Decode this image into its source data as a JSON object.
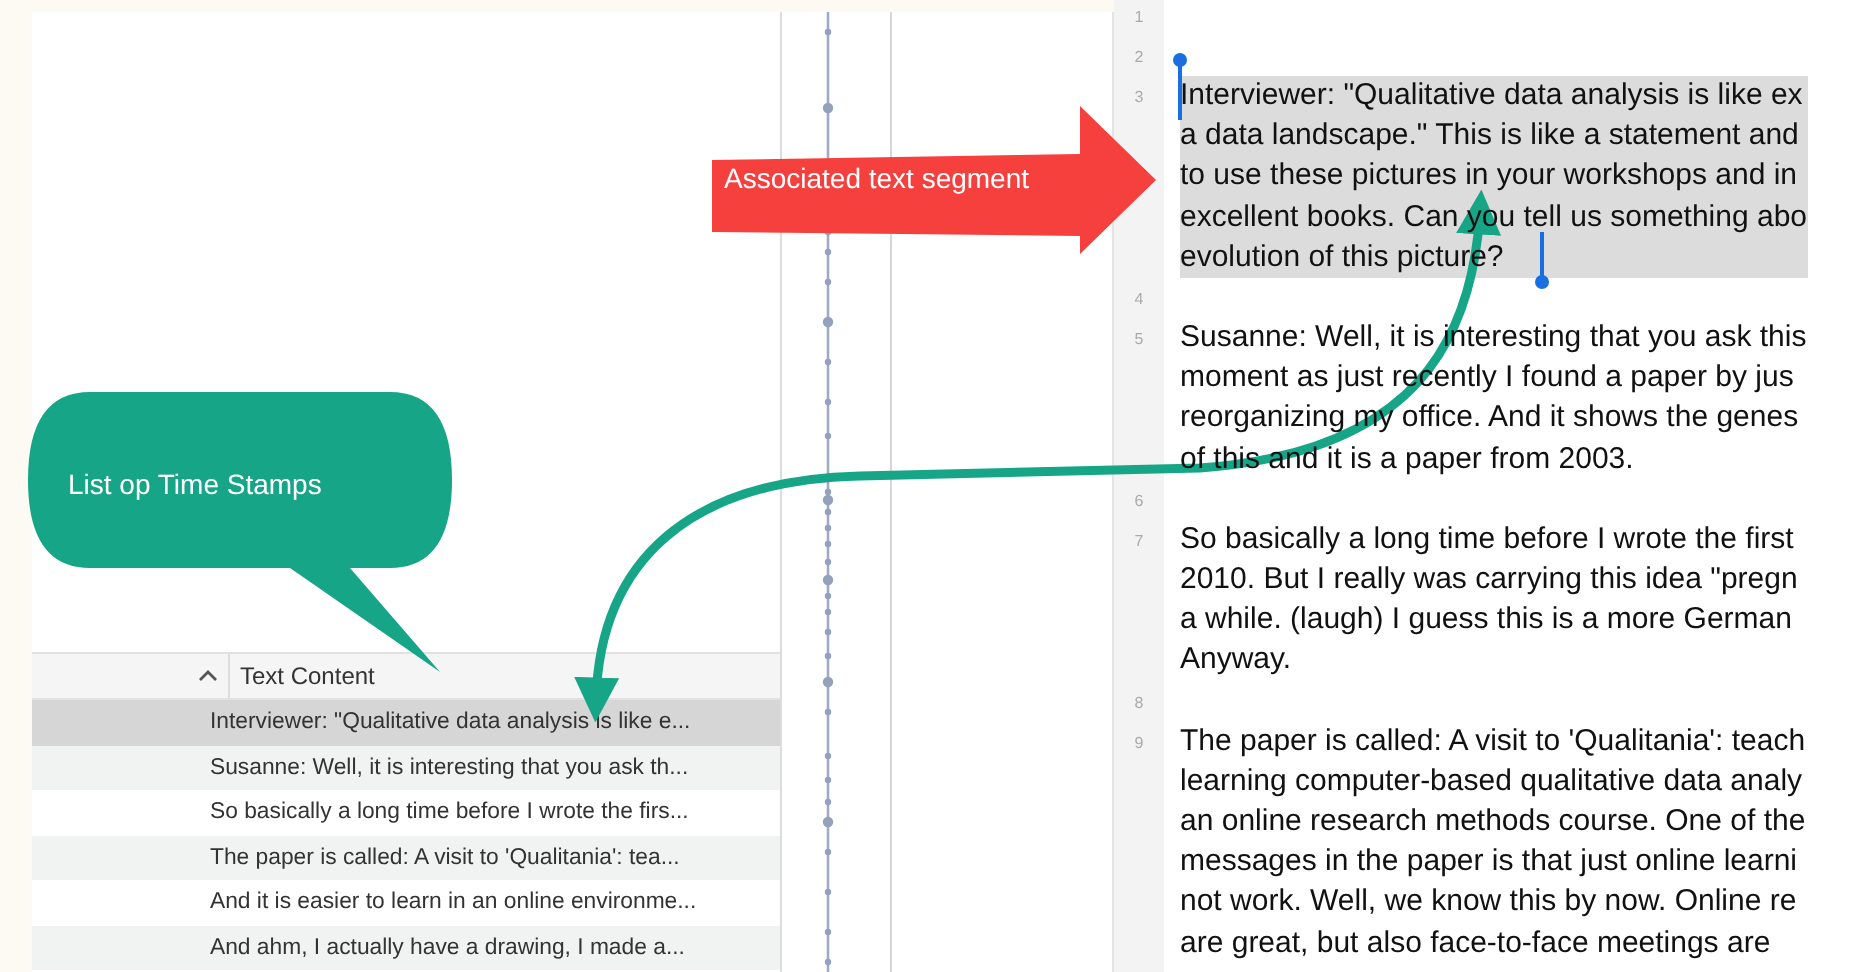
{
  "table": {
    "columns": [
      {
        "label": "Text Content"
      }
    ],
    "rows": [
      {
        "text": "Interviewer: \"Qualitative data analysis is like e...",
        "selected": true
      },
      {
        "text": "Susanne: Well, it is interesting that you ask th...",
        "selected": false
      },
      {
        "text": "So basically a long time before I wrote the firs...",
        "selected": false
      },
      {
        "text": "The paper is called: A visit to 'Qualitania': tea...",
        "selected": false
      },
      {
        "text": "And it is easier to learn in an online environme...",
        "selected": false
      },
      {
        "text": "And ahm, I actually have a drawing, I made a...",
        "selected": false
      }
    ]
  },
  "transcript": {
    "paragraphs": [
      {
        "number": "1",
        "selected": false
      },
      {
        "number": "2",
        "selected": false
      },
      {
        "number": "3",
        "selected": true,
        "lines": [
          "Interviewer: \"Qualitative data analysis is like ex",
          "a data landscape.\" This is like a statement and",
          "to use these pictures in your workshops and in",
          "excellent books. Can you tell us something abo",
          "evolution of this picture?"
        ]
      },
      {
        "number": "4",
        "selected": false
      },
      {
        "number": "5",
        "selected": false,
        "lines": [
          "Susanne: Well, it is interesting that you ask this",
          "moment as just recently I found a paper by jus",
          "reorganizing my office. And it shows the genes",
          "of this and it is a paper from 2003."
        ]
      },
      {
        "number": "6",
        "selected": false
      },
      {
        "number": "7",
        "selected": false,
        "lines": [
          "So basically a long time before I wrote the first",
          "2010. But I really was carrying this idea \"pregn",
          "a while. (laugh) I guess this is a more German",
          "Anyway."
        ]
      },
      {
        "number": "8",
        "selected": false
      },
      {
        "number": "9",
        "selected": false,
        "lines": [
          "The paper is called: A visit to 'Qualitania': teach",
          "learning computer-based qualitative data analy",
          "an online research methods course. One of the",
          "messages in the paper is that just online learni",
          "not work. Well, we know this by now. Online re",
          "are great, but also face-to-face meetings are"
        ]
      }
    ]
  },
  "annotations": {
    "callout": {
      "text": "List op Time Stamps"
    },
    "pointer": {
      "text": "Associated text segment"
    }
  }
}
